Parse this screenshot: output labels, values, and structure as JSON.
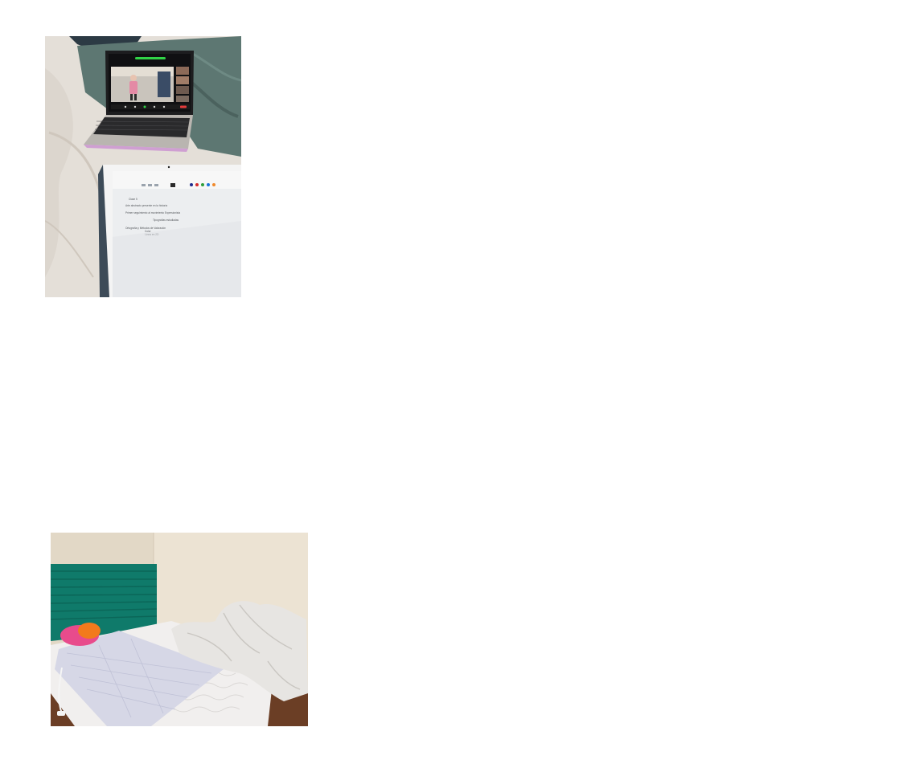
{
  "photos": [
    {
      "subject": "laptop-video-call-and-tablet-notes",
      "tablet_notes": {
        "lines": [
          "Clase 5",
          "Arte abstracto presente en la historia",
          "Primer seguimiento al movimiento Expresionista",
          "Tipografías estudiadas",
          "Ortografía y Métodos de Valoración",
          "Color",
          "Línea en 2D"
        ]
      },
      "palette": {
        "bedsheet": "#e4dfd8",
        "throw": "#5d7772",
        "laptop_body": "#b9b5b0",
        "meeting_green": "#31d447",
        "tablet_screen": "#eceef0",
        "pen_colors": [
          "#1f2a8c",
          "#d62b2b",
          "#2e9e3a",
          "#1c73d9",
          "#f08a2c"
        ]
      }
    },
    {
      "subject": "bedroom-with-unmade-bed",
      "palette": {
        "wall": "#ece3d3",
        "headboard": "#0f7a6a",
        "mattress": "#f1efee",
        "mattress_pad": "#d6d7e6",
        "duvet": "#e7e5e2",
        "pink_cloth": "#e84b8c",
        "orange_cloth": "#f27a1c",
        "floor": "#6b3e25"
      }
    }
  ]
}
